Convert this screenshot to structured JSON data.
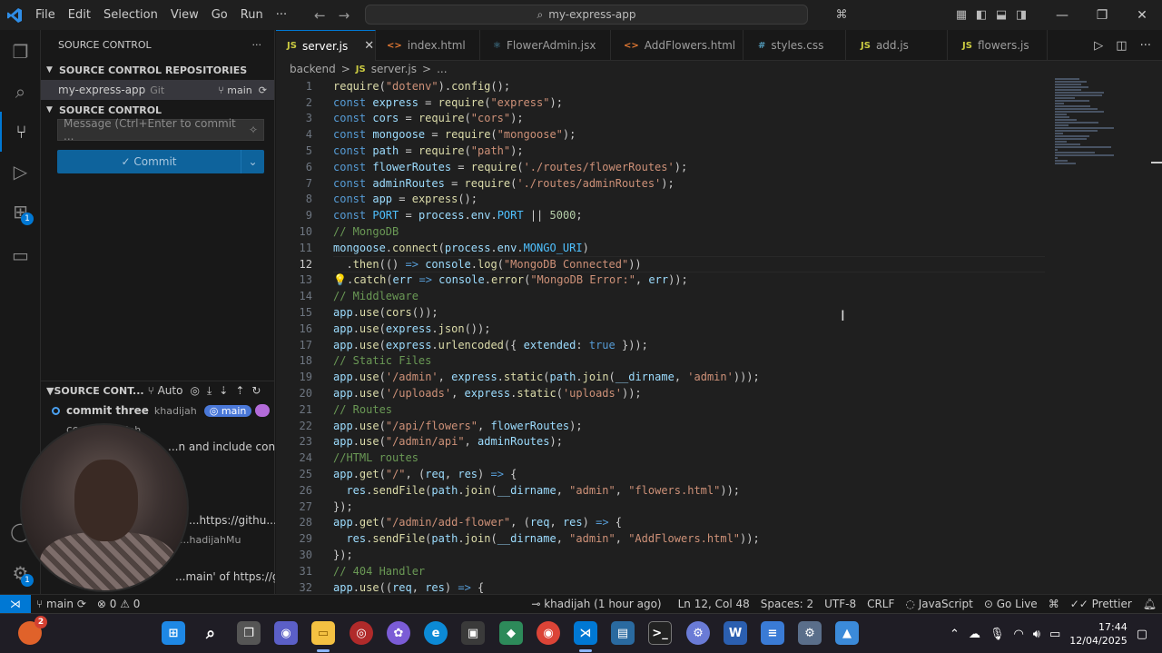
{
  "titlebar": {
    "menus": [
      "File",
      "Edit",
      "Selection",
      "View",
      "Go",
      "Run",
      "···"
    ],
    "search": "my-express-app"
  },
  "sidebar": {
    "title": "SOURCE CONTROL",
    "repositories_header": "SOURCE CONTROL REPOSITORIES",
    "repo_name": "my-express-app",
    "repo_type": "Git",
    "repo_branch": "main",
    "source_control_header": "SOURCE CONTROL",
    "message_placeholder": "Message (Ctrl+Enter to commit ...",
    "commit_label": "Commit",
    "graph_header": "SOURCE CONT...",
    "graph_auto": "Auto",
    "graph_rows": [
      {
        "message": "commit three",
        "author": "khadijah",
        "branch": "main"
      },
      {
        "message": "co...",
        "author": "...hadijah"
      },
      {
        "message": "...n and include conte..."
      },
      {
        "message": "...https://githu..."
      },
      {
        "message": "...hadijahMu"
      },
      {
        "message": "...main' of https://githu..."
      }
    ]
  },
  "tabs": [
    {
      "label": "server.js",
      "icon": "JS",
      "kind": "js",
      "active": true
    },
    {
      "label": "index.html",
      "icon": "<>",
      "kind": "html"
    },
    {
      "label": "FlowerAdmin.jsx",
      "icon": "⚛",
      "kind": "react"
    },
    {
      "label": "AddFlowers.html",
      "icon": "<>",
      "kind": "html"
    },
    {
      "label": "styles.css",
      "icon": "#",
      "kind": "css"
    },
    {
      "label": "add.js",
      "icon": "JS",
      "kind": "js"
    },
    {
      "label": "flowers.js",
      "icon": "JS",
      "kind": "js"
    }
  ],
  "breadcrumb": [
    "backend",
    ">",
    "JS",
    "server.js",
    ">",
    "..."
  ],
  "editor": {
    "current_line": 12,
    "lines": [
      [
        [
          "f",
          "require"
        ],
        [
          "t",
          "("
        ],
        [
          "s",
          "\"dotenv\""
        ],
        [
          "t",
          ")."
        ],
        [
          "f",
          "config"
        ],
        [
          "t",
          "();"
        ]
      ],
      [
        [
          "k",
          "const "
        ],
        [
          "v",
          "express"
        ],
        [
          "t",
          " = "
        ],
        [
          "f",
          "require"
        ],
        [
          "t",
          "("
        ],
        [
          "s",
          "\"express\""
        ],
        [
          "t",
          ");"
        ]
      ],
      [
        [
          "k",
          "const "
        ],
        [
          "v",
          "cors"
        ],
        [
          "t",
          " = "
        ],
        [
          "f",
          "require"
        ],
        [
          "t",
          "("
        ],
        [
          "s",
          "\"cors\""
        ],
        [
          "t",
          ");"
        ]
      ],
      [
        [
          "k",
          "const "
        ],
        [
          "v",
          "mongoose"
        ],
        [
          "t",
          " = "
        ],
        [
          "f",
          "require"
        ],
        [
          "t",
          "("
        ],
        [
          "s",
          "\"mongoose\""
        ],
        [
          "t",
          ");"
        ]
      ],
      [
        [
          "k",
          "const "
        ],
        [
          "v",
          "path"
        ],
        [
          "t",
          " = "
        ],
        [
          "f",
          "require"
        ],
        [
          "t",
          "("
        ],
        [
          "s",
          "\"path\""
        ],
        [
          "t",
          ");"
        ]
      ],
      [
        [
          "k",
          "const "
        ],
        [
          "v",
          "flowerRoutes"
        ],
        [
          "t",
          " = "
        ],
        [
          "f",
          "require"
        ],
        [
          "t",
          "("
        ],
        [
          "s",
          "'./routes/flowerRoutes'"
        ],
        [
          "t",
          ");"
        ]
      ],
      [
        [
          "k",
          "const "
        ],
        [
          "v",
          "adminRoutes"
        ],
        [
          "t",
          " = "
        ],
        [
          "f",
          "require"
        ],
        [
          "t",
          "("
        ],
        [
          "s",
          "'./routes/adminRoutes'"
        ],
        [
          "t",
          ");"
        ]
      ],
      [
        [
          "k",
          "const "
        ],
        [
          "v",
          "app"
        ],
        [
          "t",
          " = "
        ],
        [
          "f",
          "express"
        ],
        [
          "t",
          "();"
        ]
      ],
      [
        [
          "k",
          "const "
        ],
        [
          "o",
          "PORT"
        ],
        [
          "t",
          " = "
        ],
        [
          "v",
          "process"
        ],
        [
          "t",
          "."
        ],
        [
          "v",
          "env"
        ],
        [
          "t",
          "."
        ],
        [
          "o",
          "PORT"
        ],
        [
          "t",
          " || "
        ],
        [
          "n",
          "5000"
        ],
        [
          "t",
          ";"
        ]
      ],
      [
        [
          "c",
          "// MongoDB"
        ]
      ],
      [
        [
          "v",
          "mongoose"
        ],
        [
          "t",
          "."
        ],
        [
          "f",
          "connect"
        ],
        [
          "t",
          "("
        ],
        [
          "v",
          "process"
        ],
        [
          "t",
          "."
        ],
        [
          "v",
          "env"
        ],
        [
          "t",
          "."
        ],
        [
          "o",
          "MONGO_URI"
        ],
        [
          "t",
          ")"
        ]
      ],
      [
        [
          "t",
          "  ."
        ],
        [
          "f",
          "then"
        ],
        [
          "t",
          "(() "
        ],
        [
          "k",
          "=>"
        ],
        [
          "t",
          " "
        ],
        [
          "v",
          "console"
        ],
        [
          "t",
          "."
        ],
        [
          "f",
          "log"
        ],
        [
          "t",
          "("
        ],
        [
          "s",
          "\"MongoDB Connected\""
        ],
        [
          "t",
          "))"
        ]
      ],
      [
        [
          "b",
          "💡"
        ],
        [
          "t",
          "."
        ],
        [
          "f",
          "catch"
        ],
        [
          "t",
          "("
        ],
        [
          "v",
          "err"
        ],
        [
          "t",
          " "
        ],
        [
          "k",
          "=>"
        ],
        [
          "t",
          " "
        ],
        [
          "v",
          "console"
        ],
        [
          "t",
          "."
        ],
        [
          "f",
          "error"
        ],
        [
          "t",
          "("
        ],
        [
          "s",
          "\"MongoDB Error:\""
        ],
        [
          "t",
          ", "
        ],
        [
          "v",
          "err"
        ],
        [
          "t",
          "));"
        ]
      ],
      [
        [
          "c",
          "// Middleware"
        ]
      ],
      [
        [
          "v",
          "app"
        ],
        [
          "t",
          "."
        ],
        [
          "f",
          "use"
        ],
        [
          "t",
          "("
        ],
        [
          "f",
          "cors"
        ],
        [
          "t",
          "());"
        ]
      ],
      [
        [
          "v",
          "app"
        ],
        [
          "t",
          "."
        ],
        [
          "f",
          "use"
        ],
        [
          "t",
          "("
        ],
        [
          "v",
          "express"
        ],
        [
          "t",
          "."
        ],
        [
          "f",
          "json"
        ],
        [
          "t",
          "());"
        ]
      ],
      [
        [
          "v",
          "app"
        ],
        [
          "t",
          "."
        ],
        [
          "f",
          "use"
        ],
        [
          "t",
          "("
        ],
        [
          "v",
          "express"
        ],
        [
          "t",
          "."
        ],
        [
          "f",
          "urlencoded"
        ],
        [
          "t",
          "({ "
        ],
        [
          "v",
          "extended"
        ],
        [
          "t",
          ": "
        ],
        [
          "k",
          "true"
        ],
        [
          "t",
          " }));"
        ]
      ],
      [
        [
          "c",
          "// Static Files"
        ]
      ],
      [
        [
          "v",
          "app"
        ],
        [
          "t",
          "."
        ],
        [
          "f",
          "use"
        ],
        [
          "t",
          "("
        ],
        [
          "s",
          "'/admin'"
        ],
        [
          "t",
          ", "
        ],
        [
          "v",
          "express"
        ],
        [
          "t",
          "."
        ],
        [
          "f",
          "static"
        ],
        [
          "t",
          "("
        ],
        [
          "v",
          "path"
        ],
        [
          "t",
          "."
        ],
        [
          "f",
          "join"
        ],
        [
          "t",
          "("
        ],
        [
          "v",
          "__dirname"
        ],
        [
          "t",
          ", "
        ],
        [
          "s",
          "'admin'"
        ],
        [
          "t",
          ")));"
        ]
      ],
      [
        [
          "v",
          "app"
        ],
        [
          "t",
          "."
        ],
        [
          "f",
          "use"
        ],
        [
          "t",
          "("
        ],
        [
          "s",
          "'/uploads'"
        ],
        [
          "t",
          ", "
        ],
        [
          "v",
          "express"
        ],
        [
          "t",
          "."
        ],
        [
          "f",
          "static"
        ],
        [
          "t",
          "("
        ],
        [
          "s",
          "'uploads'"
        ],
        [
          "t",
          "));"
        ]
      ],
      [
        [
          "c",
          "// Routes"
        ]
      ],
      [
        [
          "v",
          "app"
        ],
        [
          "t",
          "."
        ],
        [
          "f",
          "use"
        ],
        [
          "t",
          "("
        ],
        [
          "s",
          "\"/api/flowers\""
        ],
        [
          "t",
          ", "
        ],
        [
          "v",
          "flowerRoutes"
        ],
        [
          "t",
          ");"
        ]
      ],
      [
        [
          "v",
          "app"
        ],
        [
          "t",
          "."
        ],
        [
          "f",
          "use"
        ],
        [
          "t",
          "("
        ],
        [
          "s",
          "\"/admin/api\""
        ],
        [
          "t",
          ", "
        ],
        [
          "v",
          "adminRoutes"
        ],
        [
          "t",
          ");"
        ]
      ],
      [
        [
          "c",
          "//HTML routes"
        ]
      ],
      [
        [
          "v",
          "app"
        ],
        [
          "t",
          "."
        ],
        [
          "f",
          "get"
        ],
        [
          "t",
          "("
        ],
        [
          "s",
          "\"/\""
        ],
        [
          "t",
          ", ("
        ],
        [
          "v",
          "req"
        ],
        [
          "t",
          ", "
        ],
        [
          "v",
          "res"
        ],
        [
          "t",
          ") "
        ],
        [
          "k",
          "=>"
        ],
        [
          "t",
          " {"
        ]
      ],
      [
        [
          "t",
          "  "
        ],
        [
          "v",
          "res"
        ],
        [
          "t",
          "."
        ],
        [
          "f",
          "sendFile"
        ],
        [
          "t",
          "("
        ],
        [
          "v",
          "path"
        ],
        [
          "t",
          "."
        ],
        [
          "f",
          "join"
        ],
        [
          "t",
          "("
        ],
        [
          "v",
          "__dirname"
        ],
        [
          "t",
          ", "
        ],
        [
          "s",
          "\"admin\""
        ],
        [
          "t",
          ", "
        ],
        [
          "s",
          "\"flowers.html\""
        ],
        [
          "t",
          "));"
        ]
      ],
      [
        [
          "t",
          "});"
        ]
      ],
      [
        [
          "v",
          "app"
        ],
        [
          "t",
          "."
        ],
        [
          "f",
          "get"
        ],
        [
          "t",
          "("
        ],
        [
          "s",
          "\"/admin/add-flower\""
        ],
        [
          "t",
          ", ("
        ],
        [
          "v",
          "req"
        ],
        [
          "t",
          ", "
        ],
        [
          "v",
          "res"
        ],
        [
          "t",
          ") "
        ],
        [
          "k",
          "=>"
        ],
        [
          "t",
          " {"
        ]
      ],
      [
        [
          "t",
          "  "
        ],
        [
          "v",
          "res"
        ],
        [
          "t",
          "."
        ],
        [
          "f",
          "sendFile"
        ],
        [
          "t",
          "("
        ],
        [
          "v",
          "path"
        ],
        [
          "t",
          "."
        ],
        [
          "f",
          "join"
        ],
        [
          "t",
          "("
        ],
        [
          "v",
          "__dirname"
        ],
        [
          "t",
          ", "
        ],
        [
          "s",
          "\"admin\""
        ],
        [
          "t",
          ", "
        ],
        [
          "s",
          "\"AddFlowers.html\""
        ],
        [
          "t",
          "));"
        ]
      ],
      [
        [
          "t",
          "});"
        ]
      ],
      [
        [
          "c",
          "// 404 Handler"
        ]
      ],
      [
        [
          "v",
          "app"
        ],
        [
          "t",
          "."
        ],
        [
          "f",
          "use"
        ],
        [
          "t",
          "(("
        ],
        [
          "v",
          "req"
        ],
        [
          "t",
          ", "
        ],
        [
          "v",
          "res"
        ],
        [
          "t",
          ") "
        ],
        [
          "k",
          "=>"
        ],
        [
          "t",
          " {"
        ]
      ]
    ]
  },
  "statusbar": {
    "branch": "main",
    "problems": "⊗ 0 ⚠ 0",
    "blame": "khadijah (1 hour ago)",
    "position": "Ln 12, Col 48",
    "spaces": "Spaces: 2",
    "encoding": "UTF-8",
    "eol": "CRLF",
    "language": "JavaScript",
    "golive": "Go Live",
    "prettier": "Prettier"
  },
  "taskbar": {
    "time": "17:44",
    "date": "12/04/2025",
    "notification_count": "2"
  },
  "colors": {
    "accent": "#0078d4",
    "editor_bg": "#1f1f1f",
    "sidebar_bg": "#181818"
  }
}
